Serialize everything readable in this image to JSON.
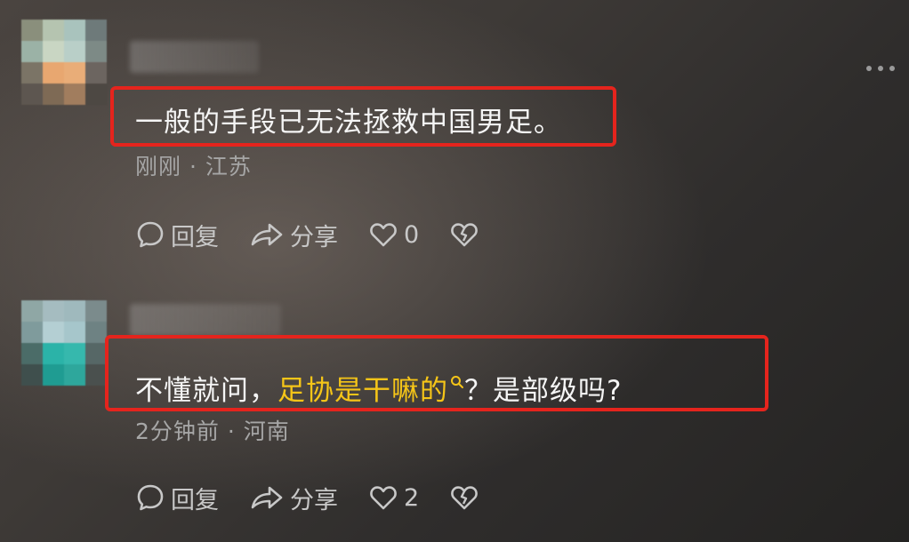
{
  "comments": [
    {
      "text": "一般的手段已无法拯救中国男足。",
      "meta": "刚刚 · 江苏",
      "reply_label": "回复",
      "share_label": "分享",
      "like_count": "0"
    },
    {
      "text_before": "不懂就问，",
      "text_link": "足协是干嘛的",
      "text_after": "？是部级吗?",
      "meta": "2分钟前 · 河南",
      "reply_label": "回复",
      "share_label": "分享",
      "like_count": "2"
    }
  ],
  "colors": {
    "highlight_box": "#e5241d",
    "link_text": "#f5c518"
  },
  "icons": [
    "more-icon",
    "reply-icon",
    "share-icon",
    "like-icon",
    "dislike-icon",
    "search-icon"
  ]
}
